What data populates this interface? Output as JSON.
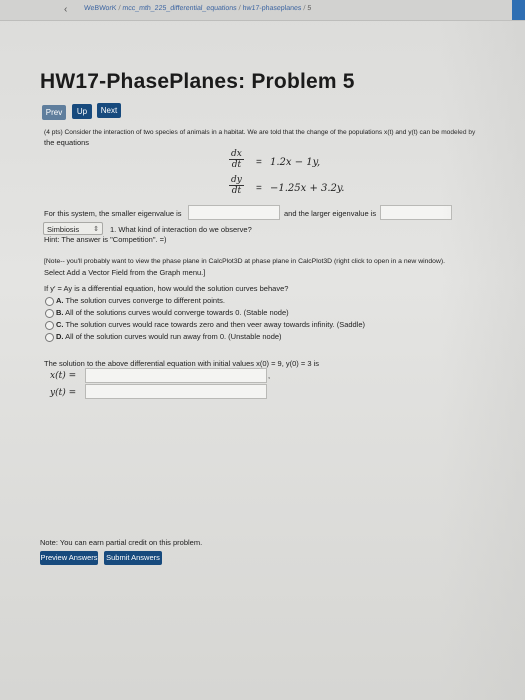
{
  "breadcrumb": {
    "back_arrow": "‹",
    "items": [
      "WeBWorK",
      "mcc_mth_225_differential_equations",
      "hw17-phaseplanes",
      "5"
    ]
  },
  "page_title": "HW17-PhasePlanes: Problem 5",
  "nav": {
    "prev": "Prev",
    "up": "Up",
    "next": "Next"
  },
  "problem": {
    "intro_line1": "(4 pts) Consider the interaction of two species of animals in a habitat. We are told that the change of the populations x(t) and y(t) can be modeled by",
    "intro_line2": "the equations",
    "eq1": {
      "num": "dx",
      "den": "dt",
      "rhs": "1.2x − 1y,"
    },
    "eq2": {
      "num": "dy",
      "den": "dt",
      "rhs": "−1.25x + 3.2y."
    },
    "eigen_small_label": "For this system, the smaller eigenvalue is",
    "eigen_large_label": "and the larger eigenvalue is",
    "select_value": "Simbiosis",
    "q1": "1. What kind of interaction do we observe?",
    "hint": "Hint: The answer is \"Competition\". =)",
    "note_line1": "[Note-- you'll probably want to view the phase plane in CalcPlot3D at phase plane in CalcPlot3D (right click to open in a new window).",
    "note_line2": "Select Add a Vector Field from the Graph menu.]",
    "q2": "If y′ = Ay is a differential equation, how would the solution curves behave?",
    "options": [
      {
        "key": "A.",
        "text": "The solution curves converge to different points."
      },
      {
        "key": "B.",
        "text": "All of the solutions curves would converge towards 0. (Stable node)"
      },
      {
        "key": "C.",
        "text": "The solution curves would race towards zero and then veer away towards infinity. (Saddle)"
      },
      {
        "key": "D.",
        "text": "All of the solution curves would run away from 0. (Unstable node)"
      }
    ],
    "ic_text": "The solution to the above differential equation with initial values x(0) = 9, y(0) = 3 is",
    "x_label": "x(t) =",
    "y_label": "y(t) =",
    "partial_credit_note": "Note: You can earn partial credit on this problem."
  },
  "actions": {
    "preview": "Preview Answers",
    "submit": "Submit Answers"
  },
  "colors": {
    "button": "#174a7d",
    "link": "#3a63a0",
    "tab_accent": "#2f6fb3"
  }
}
